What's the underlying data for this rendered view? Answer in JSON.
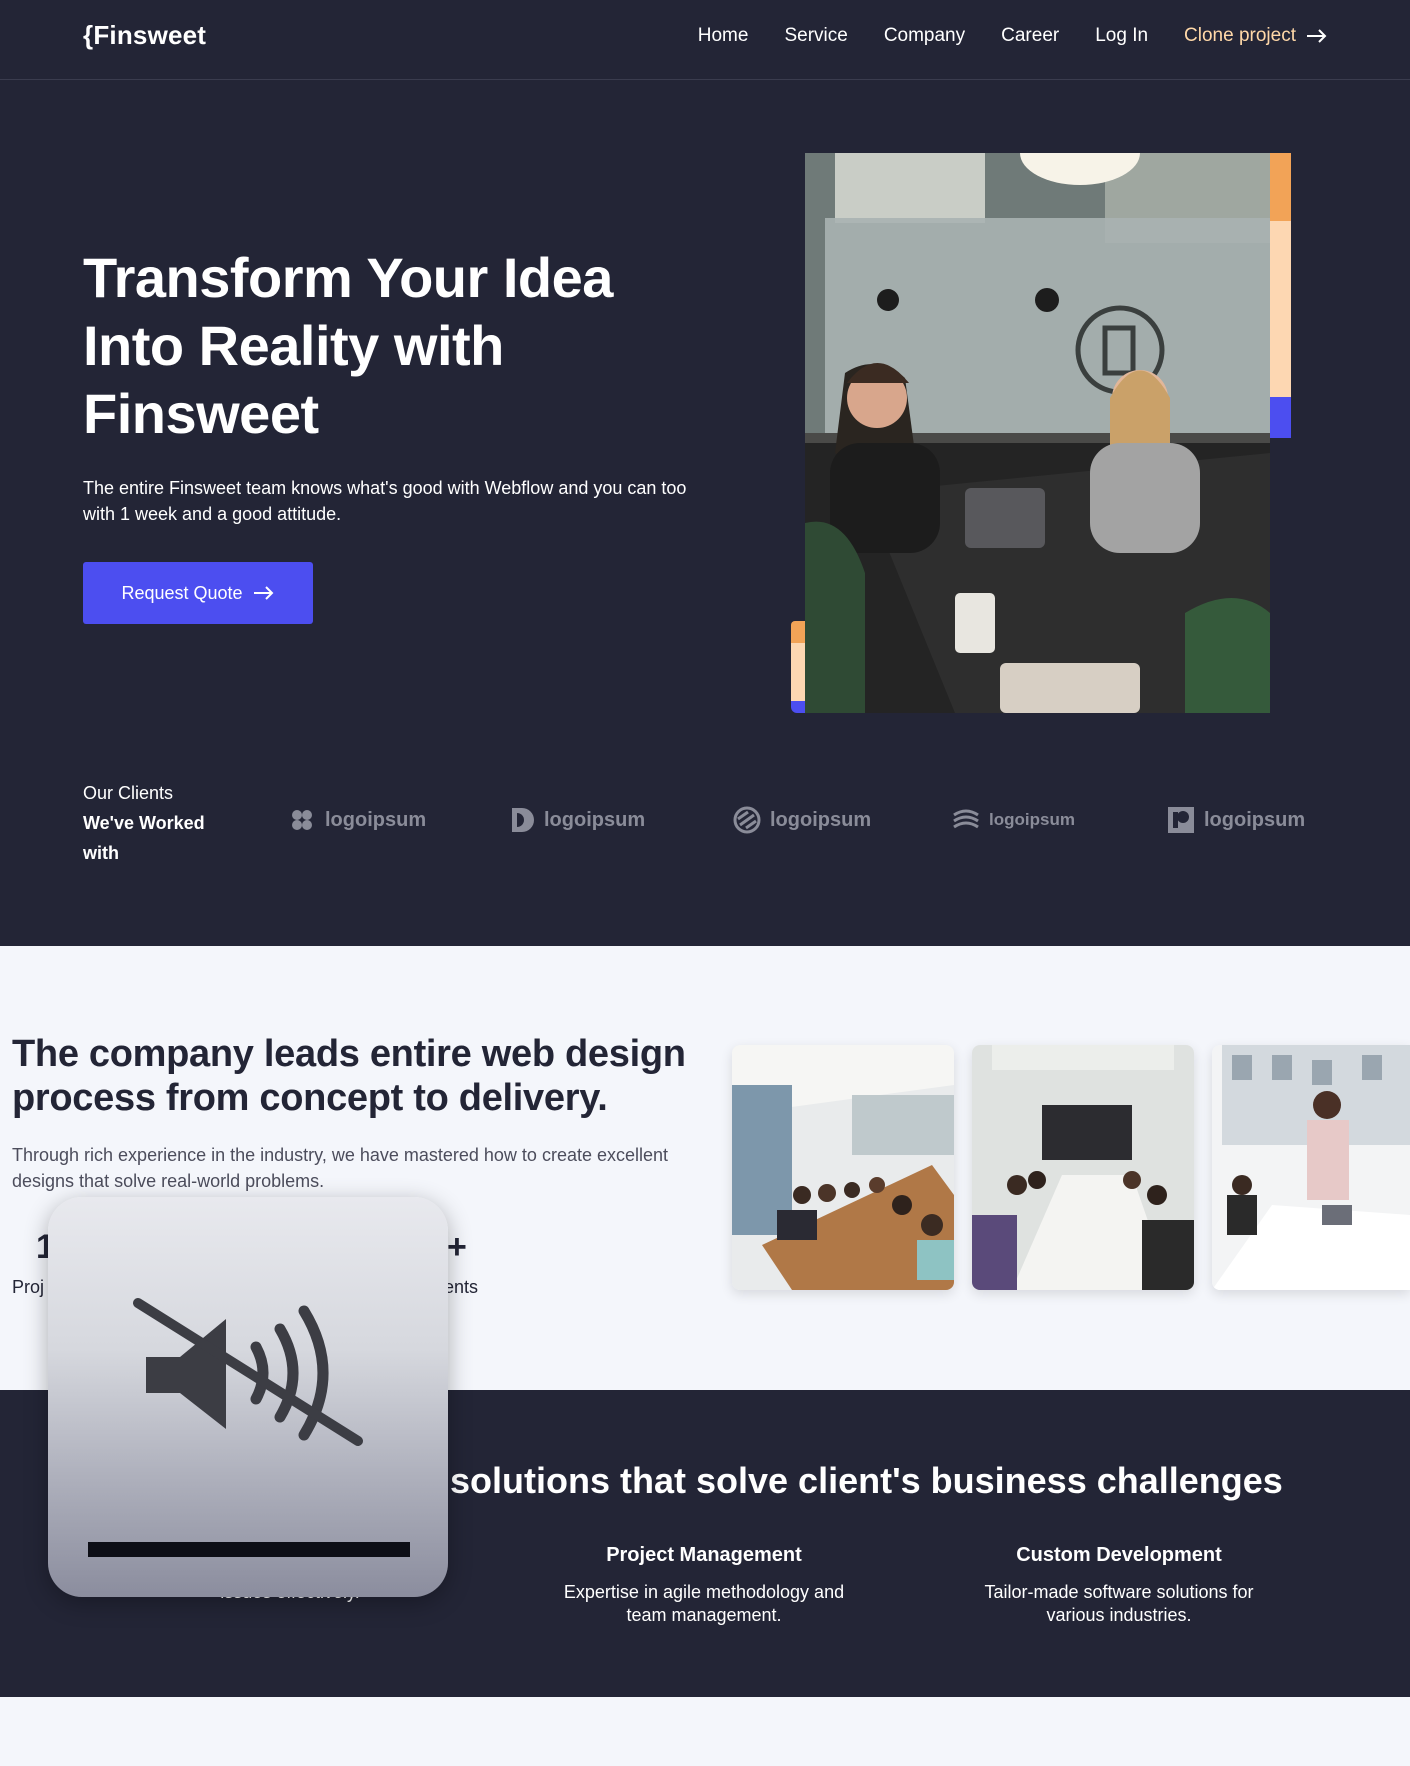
{
  "nav": {
    "logo": "{Finsweet",
    "links": [
      "Home",
      "Service",
      "Company",
      "Career",
      "Log In"
    ],
    "cta": "Clone project"
  },
  "hero": {
    "title": "Transform Your Idea Into Reality with Finsweet",
    "subtitle": "The entire Finsweet team knows what's good with Webflow and you can too with 1 week and a good attitude.",
    "button": "Request Quote"
  },
  "clients": {
    "lead": "Our Clients",
    "bold": "We've Worked with",
    "logos": [
      "logoipsum",
      "logoipsum",
      "logoipsum",
      "logoipsum",
      "logoipsum"
    ]
  },
  "about": {
    "title": "The company leads entire web design process from concept to delivery.",
    "subtitle": "Through rich experience in the industry, we have mastered how to create excellent designs that solve real-world problems.",
    "stat1_num": "1",
    "stat1_label": "Proj",
    "stat2_num": "+",
    "stat2_label": "ents"
  },
  "services": {
    "title": "solutions that solve client's business challenges",
    "items": [
      {
        "title": "",
        "desc": "24/7 support to address technical issues effectively."
      },
      {
        "title": "Project Management",
        "desc": "Expertise in agile methodology and team management."
      },
      {
        "title": "Custom Development",
        "desc": "Tailor-made software solutions for various industries."
      }
    ]
  },
  "colors": {
    "dark": "#232536",
    "accent": "#4c4ef0",
    "cta": "#ffd8a8",
    "orange": "#f2a357"
  },
  "hud": {
    "icon": "speaker-muted-icon"
  }
}
